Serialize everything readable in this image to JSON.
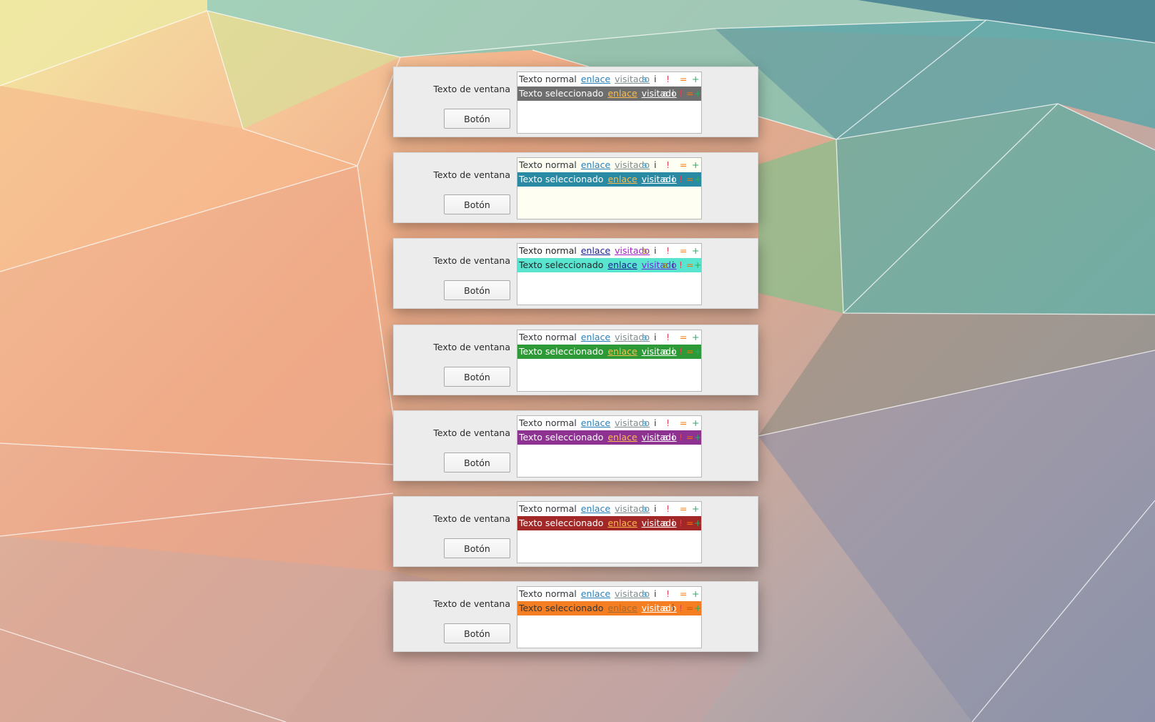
{
  "labels": {
    "window_text": "Texto de ventana",
    "button": "Botón",
    "normal_text": "Texto normal",
    "link": "enlace",
    "visited": "visitado",
    "selected_text": "Texto seleccionado",
    "glyph_a": "a",
    "glyph_i": "i",
    "glyph_excl": "!",
    "glyph_eq": "=",
    "glyph_plus": "+"
  },
  "schemes": [
    {
      "view_bg": "#ffffff",
      "normal": {
        "text": "#31363b",
        "link": "#2980b9",
        "visited": "#7f8c8d",
        "a": "#3daee9",
        "i": "#31363b",
        "excl": "#da4453",
        "eq": "#f67400",
        "plus": "#27ae60"
      },
      "sel": {
        "bg": "#6e6e6e",
        "text": "#ffffff",
        "link": "#fdbc4b",
        "visited": "#ffffff",
        "a": "#ffffff",
        "i": "#ffffff",
        "excl": "#da4453",
        "eq": "#f67400",
        "plus": "#27ae60"
      }
    },
    {
      "view_bg": "#fefef2",
      "normal": {
        "text": "#31363b",
        "link": "#2980b9",
        "visited": "#7f8c8d",
        "a": "#3daee9",
        "i": "#31363b",
        "excl": "#da4453",
        "eq": "#f67400",
        "plus": "#27ae60"
      },
      "sel": {
        "bg": "#2b8aa3",
        "text": "#ffffff",
        "link": "#fdbc4b",
        "visited": "#ffffff",
        "a": "#ffffff",
        "i": "#ffffff",
        "excl": "#da4453",
        "eq": "#f67400",
        "plus": "#27ae60"
      }
    },
    {
      "view_bg": "#ffffff",
      "normal": {
        "text": "#232629",
        "link": "#1b1e91",
        "visited": "#a21fc5",
        "a": "#a0840a",
        "i": "#31363b",
        "excl": "#da4453",
        "eq": "#f67400",
        "plus": "#27ae60"
      },
      "sel": {
        "bg": "#58e4cf",
        "text": "#232629",
        "link": "#1b1e91",
        "visited": "#6f2bd8",
        "a": "#a0840a",
        "i": "#31363b",
        "excl": "#da4453",
        "eq": "#f67400",
        "plus": "#27ae60"
      }
    },
    {
      "view_bg": "#ffffff",
      "normal": {
        "text": "#31363b",
        "link": "#2980b9",
        "visited": "#7f8c8d",
        "a": "#3daee9",
        "i": "#31363b",
        "excl": "#da4453",
        "eq": "#f67400",
        "plus": "#27ae60"
      },
      "sel": {
        "bg": "#2e9a37",
        "text": "#ffffff",
        "link": "#fdbc4b",
        "visited": "#ffffff",
        "a": "#ffffff",
        "i": "#ffffff",
        "excl": "#da4453",
        "eq": "#f67400",
        "plus": "#27ae60"
      }
    },
    {
      "view_bg": "#ffffff",
      "normal": {
        "text": "#31363b",
        "link": "#2980b9",
        "visited": "#7f8c8d",
        "a": "#3daee9",
        "i": "#31363b",
        "excl": "#da4453",
        "eq": "#f67400",
        "plus": "#27ae60"
      },
      "sel": {
        "bg": "#8e3291",
        "text": "#ffffff",
        "link": "#fdbc4b",
        "visited": "#ffffff",
        "a": "#ffffff",
        "i": "#ffffff",
        "excl": "#da4453",
        "eq": "#f67400",
        "plus": "#27ae60"
      }
    },
    {
      "view_bg": "#ffffff",
      "normal": {
        "text": "#31363b",
        "link": "#2980b9",
        "visited": "#7f8c8d",
        "a": "#3daee9",
        "i": "#31363b",
        "excl": "#da4453",
        "eq": "#f67400",
        "plus": "#27ae60"
      },
      "sel": {
        "bg": "#a22727",
        "text": "#ffffff",
        "link": "#fdbc4b",
        "visited": "#ffffff",
        "a": "#ffffff",
        "i": "#ffffff",
        "excl": "#da4453",
        "eq": "#f67400",
        "plus": "#27ae60"
      }
    },
    {
      "view_bg": "#ffffff",
      "normal": {
        "text": "#31363b",
        "link": "#2980b9",
        "visited": "#7f8c8d",
        "a": "#3daee9",
        "i": "#31363b",
        "excl": "#da4453",
        "eq": "#f67400",
        "plus": "#27ae60"
      },
      "sel": {
        "bg": "#f67e22",
        "text": "#31363b",
        "link": "#a36a2d",
        "visited": "#ffffff",
        "a": "#ffffff",
        "i": "#31363b",
        "excl": "#da4453",
        "eq": "#d35400",
        "plus": "#27ae60"
      }
    }
  ]
}
